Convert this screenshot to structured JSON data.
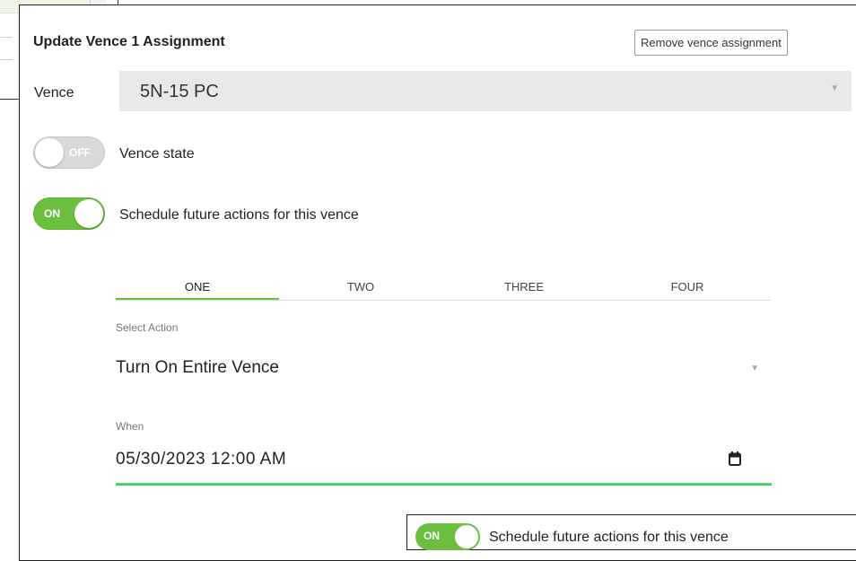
{
  "dialog": {
    "title": "Update Vence 1 Assignment",
    "remove_button": "Remove vence assignment",
    "vence_label": "Vence",
    "vence_value": "5N-15 PC",
    "vence_state": {
      "toggle_text": "OFF",
      "label": "Vence state",
      "on": false
    },
    "schedule": {
      "toggle_text": "ON",
      "label": "Schedule future actions for this vence",
      "on": true
    },
    "tabs": [
      {
        "label": "ONE",
        "active": true
      },
      {
        "label": "TWO",
        "active": false
      },
      {
        "label": "THREE",
        "active": false
      },
      {
        "label": "FOUR",
        "active": false
      }
    ],
    "select_action_label": "Select Action",
    "select_action_value": "Turn On Entire Vence",
    "when_label": "When",
    "when_value": "05/30/2023 12:00 AM",
    "bottom_peek": {
      "toggle_text": "ON",
      "label": "Schedule future actions for this vence"
    }
  },
  "colors": {
    "accent_green": "#6cbf3e",
    "input_underline": "#4cd16b",
    "select_bg": "#e8e8e8"
  },
  "icons": {
    "select_caret": "chevron-down-icon",
    "calendar": "calendar-icon"
  }
}
